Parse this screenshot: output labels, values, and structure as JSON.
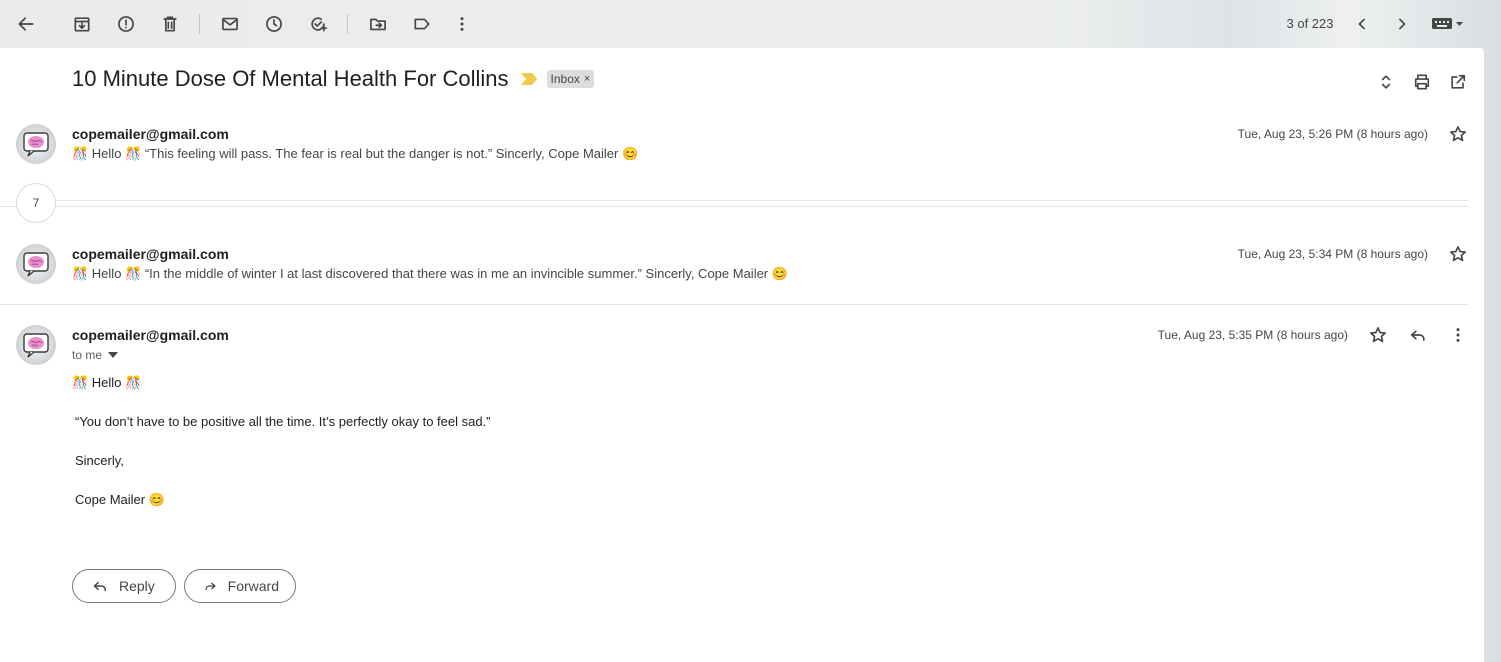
{
  "toolbar": {
    "counter": "3 of 223",
    "icons": [
      "back-arrow-icon",
      "archive-icon",
      "report-spam-icon",
      "delete-icon",
      "mark-unread-icon",
      "snooze-icon",
      "add-to-tasks-icon",
      "move-to-icon",
      "labels-icon",
      "more-vert-icon",
      "older-chevron-icon",
      "newer-chevron-icon",
      "keyboard-icon"
    ]
  },
  "thread": {
    "subject": "10 Minute Dose Of Mental Health For Collins",
    "label": "Inbox",
    "label_remove": "×",
    "importance_color": "#f2c94c"
  },
  "messages": [
    {
      "sender": "copemailer@gmail.com",
      "snippet": "🎊 Hello 🎊 “This feeling will pass. The fear is real but the danger is not.” Sincerly, Cope Mailer 😊",
      "date": "Tue, Aug 23, 5:26 PM (8 hours ago)"
    },
    {
      "sender": "copemailer@gmail.com",
      "snippet": "🎊 Hello 🎊 “In the middle of winter I at last discovered that there was in me an invincible summer.” Sincerly, Cope Mailer 😊",
      "date": "Tue, Aug 23, 5:34 PM (8 hours ago)"
    }
  ],
  "collapsed_count": "7",
  "open_message": {
    "sender": "copemailer@gmail.com",
    "recipient": "to me",
    "date": "Tue, Aug 23, 5:35 PM (8 hours ago)",
    "greeting": "🎊 Hello 🎊",
    "quote": "“You don’t have to be positive all the time. It’s perfectly okay to feel sad.”",
    "closing": "Sincerly,",
    "signature": "Cope Mailer 😊"
  },
  "actions": {
    "reply_label": "Reply",
    "forward_label": "Forward"
  }
}
